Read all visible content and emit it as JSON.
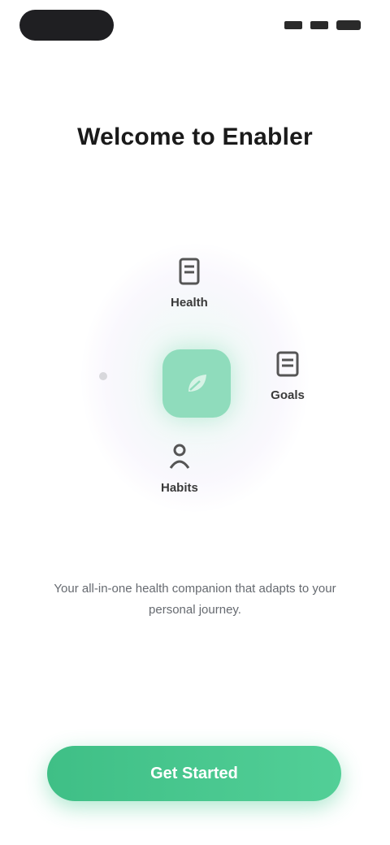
{
  "title": "Welcome to Enabler",
  "diagram": {
    "nodes": [
      {
        "label": "Health",
        "icon": "document-icon"
      },
      {
        "label": "Goals",
        "icon": "list-icon"
      },
      {
        "label": "Habits",
        "icon": "person-icon"
      }
    ],
    "center_icon": "leaf-icon"
  },
  "description": "Your all-in-one health companion that adapts to your personal journey.",
  "cta": {
    "label": "Get Started"
  },
  "colors": {
    "accent": "#4cc98f",
    "center_node": "#8fdcbc"
  }
}
